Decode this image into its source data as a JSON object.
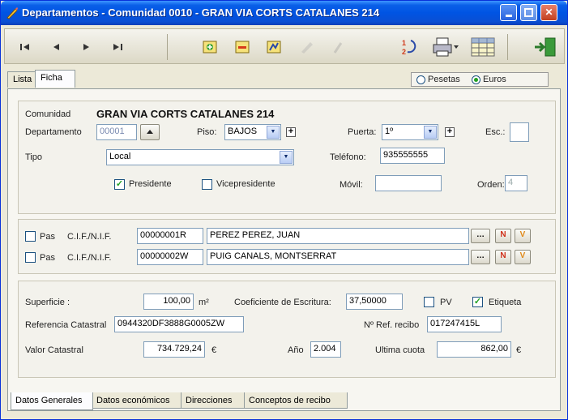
{
  "window": {
    "title": "Departamentos - Comunidad 0010 - GRAN VIA CORTS CATALANES 214",
    "minimize": "",
    "maximize": "",
    "close": "✕"
  },
  "toolbar": {
    "first": "⏮",
    "prev": "◀",
    "next": "▶",
    "last": "⏭"
  },
  "tabs_top": [
    "Lista",
    "Ficha"
  ],
  "currency": {
    "pesetas": "Pesetas",
    "euros": "Euros",
    "selected": "Euros"
  },
  "header": {
    "comunidad_label": "Comunidad",
    "comunidad_value": "GRAN VIA CORTS CATALANES 214",
    "departamento_label": "Departamento",
    "departamento_value": "00001",
    "piso_label": "Piso:",
    "piso_value": "BAJOS",
    "puerta_label": "Puerta:",
    "puerta_value": "1º",
    "esc_label": "Esc.:",
    "esc_value": "",
    "tipo_label": "Tipo",
    "tipo_value": "Local",
    "telefono_label": "Teléfono:",
    "telefono_value": "935555555",
    "presidente_label": "Presidente",
    "presidente_checked": true,
    "vicepresidente_label": "Vicepresidente",
    "vicepresidente_checked": false,
    "movil_label": "Móvil:",
    "movil_value": "",
    "orden_label": "Orden:",
    "orden_value": "4"
  },
  "owners": [
    {
      "pas_label": "Pas",
      "cif_label": "C.I.F./N.I.F.",
      "cif": "00000001R",
      "name": "PEREZ PEREZ, JUAN"
    },
    {
      "pas_label": "Pas",
      "cif_label": "C.I.F./N.I.F.",
      "cif": "00000002W",
      "name": "PUIG CANALS, MONTSERRAT"
    }
  ],
  "details": {
    "superficie_label": "Superficie :",
    "superficie_value": "100,00",
    "superficie_unit": "m²",
    "coef_label": "Coeficiente de Escritura:",
    "coef_value": "37,50000",
    "pv_label": "PV",
    "etiqueta_label": "Etiqueta",
    "ref_label": "Referencia Catastral",
    "ref_value": "0944320DF3888G0005ZW",
    "refrecibo_label": "Nº Ref. recibo",
    "refrecibo_value": "017247415L",
    "valor_label": "Valor Catastral",
    "valor_value": "734.729,24",
    "valor_unit": "€",
    "anio_label": "Año",
    "anio_value": "2.004",
    "cuota_label": "Ultima cuota",
    "cuota_value": "862,00",
    "cuota_unit": "€"
  },
  "tabs_bottom": [
    "Datos Generales",
    "Datos económicos",
    "Direcciones",
    "Conceptos de recibo"
  ],
  "colors": {
    "title_bar": "#0054e3",
    "close_button": "#c2401f",
    "check_mark": "#21a121",
    "nif_button_red": "#d0301a",
    "nif_button_orange": "#e08a1a"
  }
}
